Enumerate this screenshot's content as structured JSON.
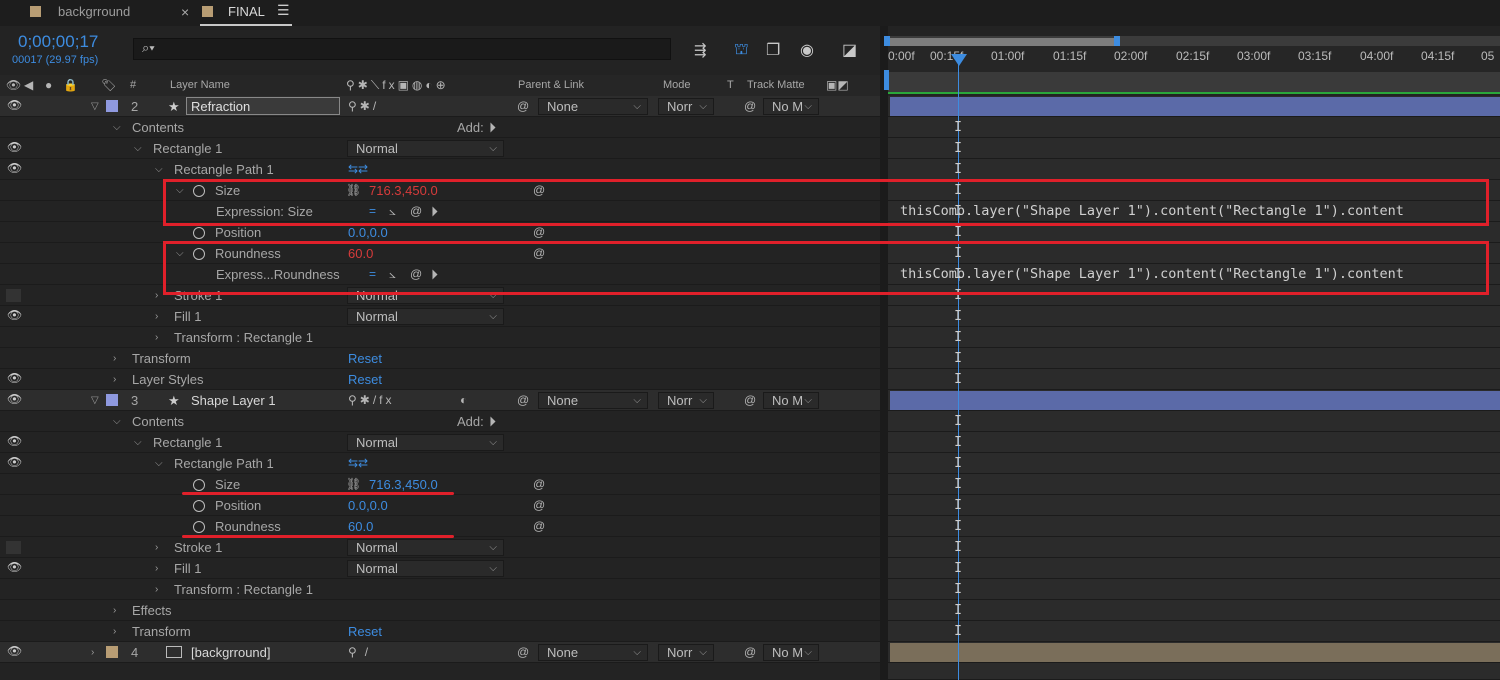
{
  "tabs": [
    {
      "label": "backgrround"
    },
    {
      "label": "FINAL"
    }
  ],
  "timecode": "0;00;00;17",
  "frame_info": "00017 (29.97 fps)",
  "search_placeholder": "",
  "columns": {
    "layer_name": "Layer Name",
    "parent_link": "Parent & Link",
    "mode": "Mode",
    "t": "T",
    "track_matte": "Track Matte",
    "num": "#"
  },
  "ruler_labels": [
    "0:00f",
    "00:15f",
    "01:00f",
    "01:15f",
    "02:00f",
    "02:15f",
    "03:00f",
    "03:15f",
    "04:00f",
    "04:15f",
    "05"
  ],
  "rows": {
    "r1": {
      "num": "2",
      "name": "Refraction",
      "parent": "None",
      "mode": "Norr",
      "matte": "No M"
    },
    "r2": {
      "label": "Contents",
      "add": "Add:"
    },
    "r3": {
      "label": "Rectangle 1",
      "mode": "Normal"
    },
    "r4": {
      "label": "Rectangle Path 1"
    },
    "r5": {
      "label": "Size",
      "value": "716.3,450.0"
    },
    "r6": {
      "label": "Expression: Size"
    },
    "r7": {
      "label": "Position",
      "value": "0.0,0.0"
    },
    "r8": {
      "label": "Roundness",
      "value": "60.0"
    },
    "r9": {
      "label": "Express...Roundness"
    },
    "r10": {
      "label": "Stroke 1",
      "mode": "Normal"
    },
    "r11": {
      "label": "Fill 1",
      "mode": "Normal"
    },
    "r12": {
      "label": "Transform : Rectangle 1"
    },
    "r13": {
      "label": "Transform",
      "value": "Reset"
    },
    "r14": {
      "label": "Layer Styles",
      "value": "Reset"
    },
    "r15": {
      "num": "3",
      "name": "Shape Layer 1",
      "parent": "None",
      "mode": "Norr",
      "matte": "No M"
    },
    "r16": {
      "label": "Contents",
      "add": "Add:"
    },
    "r17": {
      "label": "Rectangle 1",
      "mode": "Normal"
    },
    "r18": {
      "label": "Rectangle Path 1"
    },
    "r19": {
      "label": "Size",
      "value": "716.3,450.0"
    },
    "r20": {
      "label": "Position",
      "value": "0.0,0.0"
    },
    "r21": {
      "label": "Roundness",
      "value": "60.0"
    },
    "r22": {
      "label": "Stroke 1",
      "mode": "Normal"
    },
    "r23": {
      "label": "Fill 1",
      "mode": "Normal"
    },
    "r24": {
      "label": "Transform : Rectangle 1"
    },
    "r25": {
      "label": "Effects"
    },
    "r26": {
      "label": "Transform",
      "value": "Reset"
    },
    "r27": {
      "num": "4",
      "name": "[backgrround]",
      "parent": "None",
      "mode": "Norr",
      "matte": "No M"
    }
  },
  "expressions": {
    "size": "thisComp.layer(\"Shape Layer 1\").content(\"Rectangle 1\").content",
    "roundness": "thisComp.layer(\"Shape Layer 1\").content(\"Rectangle 1\").content"
  },
  "colors": {
    "accent": "#3d8ce0",
    "expression_value": "#d63b3b",
    "highlight": "#e0202a",
    "layer_bar": "#5b6aa8",
    "background_bar": "#7a6e5a"
  }
}
